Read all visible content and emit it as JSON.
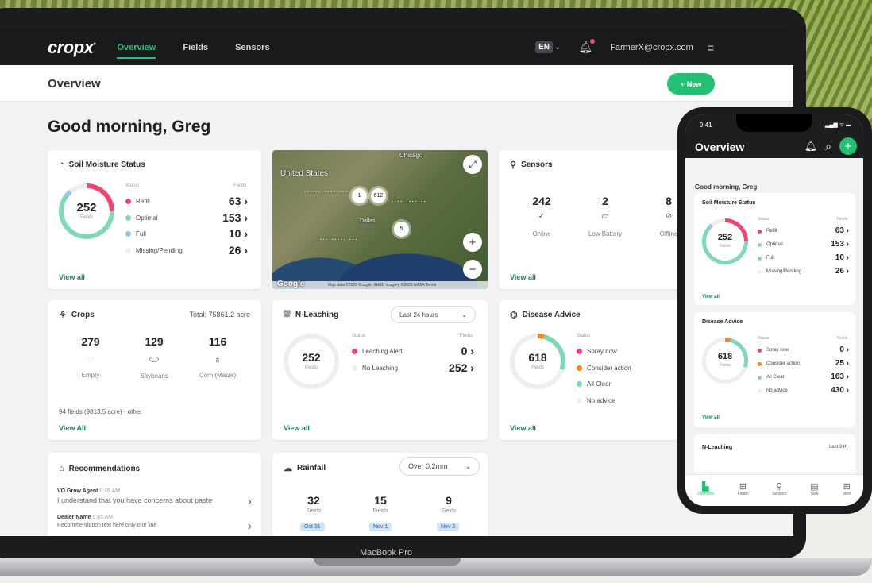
{
  "nav": {
    "logo": "cropx",
    "logo_mark": "•",
    "links": [
      "Overview",
      "Fields",
      "Sensors"
    ],
    "lang": "EN",
    "lang_chevron": "⌄",
    "bell_icon": "bell-icon",
    "user": "FarmerX@cropx.com",
    "menu_icon": "≡"
  },
  "header": {
    "title": "Overview",
    "new_button": "New",
    "new_plus": "+"
  },
  "greeting": "Good morning, Greg",
  "soil": {
    "title": "Soil Moisture Status",
    "icon": "◔",
    "total": "252",
    "total_label": "Fields",
    "col_status": "Status",
    "col_fields": "Fields",
    "rows": [
      {
        "label": "Refill",
        "value": "63 ›",
        "color": "#f0436f"
      },
      {
        "label": "Optimal",
        "value": "153 ›",
        "color": "#7fd9b5"
      },
      {
        "label": "Full",
        "value": "10 ›",
        "color": "#8ec6ee"
      },
      {
        "label": "Missing/Pending",
        "value": "26 ›",
        "color": "#eeeeee"
      }
    ],
    "view_all": "View all"
  },
  "map": {
    "country": "United States",
    "chicago": "Chicago",
    "dallas": "Dallas",
    "clusters": [
      "1",
      "612",
      "5"
    ],
    "zoom_in": "+",
    "zoom_out": "−",
    "fullscreen": "⤢",
    "google": "Google",
    "attribution": "Map data ©2025 Google, INEGI Imagery ©2025 NASA   Terms"
  },
  "sensors": {
    "title": "Sensors",
    "icon": "⚲",
    "stats": [
      {
        "n": "242",
        "i": "✓",
        "l": "Online"
      },
      {
        "n": "2",
        "i": "▭",
        "l": "Low Battery"
      },
      {
        "n": "8",
        "i": "⊘",
        "l": "Offline"
      }
    ],
    "view_all": "View all"
  },
  "crops": {
    "title": "Crops",
    "icon": "⚘",
    "total": "Total: 75861.2 acre",
    "stats": [
      {
        "n": "279",
        "i": "○",
        "l": "Empty"
      },
      {
        "n": "129",
        "i": "⬭",
        "l": "Soybeans"
      },
      {
        "n": "116",
        "i": "♁",
        "l": "Corn (Maize)"
      }
    ],
    "other": "94 fields (9813.5 acre) - other",
    "view_all": "View All"
  },
  "nleach": {
    "title": "N-Leaching",
    "icon": "⛆",
    "range": "Last 24 hours",
    "chevron": "⌄",
    "total": "252",
    "total_label": "Fields",
    "col_status": "Status",
    "col_fields": "Fields",
    "rows": [
      {
        "label": "Leaching Alert",
        "value": "0 ›",
        "color": "#f0436f"
      },
      {
        "label": "No Leaching",
        "value": "252 ›",
        "color": "#eeeeee"
      }
    ],
    "view_all": "View all"
  },
  "disease": {
    "title": "Disease Advice",
    "icon": "⌬",
    "total": "618",
    "total_label": "Fields",
    "col_status": "Status",
    "rows": [
      {
        "label": "Spray now",
        "value": "0",
        "color": "#f0436f"
      },
      {
        "label": "Consider action",
        "value": "25",
        "color": "#f5891f"
      },
      {
        "label": "All Clear",
        "value": "163",
        "color": "#7fd9b5"
      },
      {
        "label": "No advice",
        "value": "430",
        "color": "#eeeeee"
      }
    ],
    "view_all": "View all"
  },
  "reco": {
    "title": "Recommendations",
    "icon": "⌂",
    "items": [
      {
        "who": "VO Grow Agent",
        "time": "9:45 AM",
        "text": "I understand that you have concerns about paste"
      },
      {
        "who": "Dealer Name",
        "time": "9:45 AM",
        "text": "Recommendation text here only one line"
      }
    ],
    "chevron": "›"
  },
  "rain": {
    "title": "Rainfall",
    "icon": "☁",
    "range": "Over 0.2mm",
    "chevron": "⌄",
    "fields_label": "Fields",
    "stats": [
      {
        "n": "32",
        "date": "Oct 31"
      },
      {
        "n": "15",
        "date": "Nov 1"
      },
      {
        "n": "9",
        "date": "Nov 2"
      }
    ]
  },
  "laptop_label": "MacBook Pro",
  "phone": {
    "time": "9:41",
    "signal": "▂▄▆ ᯤ ▬",
    "title": "Overview",
    "bell": "♫",
    "search": "⚲",
    "plus": "+",
    "greeting": "Good morning, Greg",
    "soil_title": "Soil Moisture Status",
    "soil_total": "252",
    "soil_total_label": "Fields",
    "col_status": "Status",
    "col_fields": "Fields",
    "soil_rows": [
      {
        "label": "Refill",
        "value": "63 ›"
      },
      {
        "label": "Optimal",
        "value": "153 ›"
      },
      {
        "label": "Full",
        "value": "10 ›"
      },
      {
        "label": "Missing/Pending",
        "value": "26 ›"
      }
    ],
    "view_all": "View all",
    "disease_title": "Disease Advice",
    "disease_total": "618",
    "disease_total_label": "Fields",
    "disease_rows": [
      {
        "label": "Spray now",
        "value": "0 ›"
      },
      {
        "label": "Consider action",
        "value": "25 ›"
      },
      {
        "label": "All Clear",
        "value": "163 ›"
      },
      {
        "label": "No advice",
        "value": "430 ›"
      }
    ],
    "nleach_title": "N-Leaching",
    "nleach_range": "Last 24h",
    "tabs": [
      {
        "label": "Overview",
        "icon": "▙"
      },
      {
        "label": "Fields",
        "icon": "⊞"
      },
      {
        "label": "Sensors",
        "icon": "⚲"
      },
      {
        "label": "Task",
        "icon": "▤"
      },
      {
        "label": "More",
        "icon": "⊞"
      }
    ]
  }
}
